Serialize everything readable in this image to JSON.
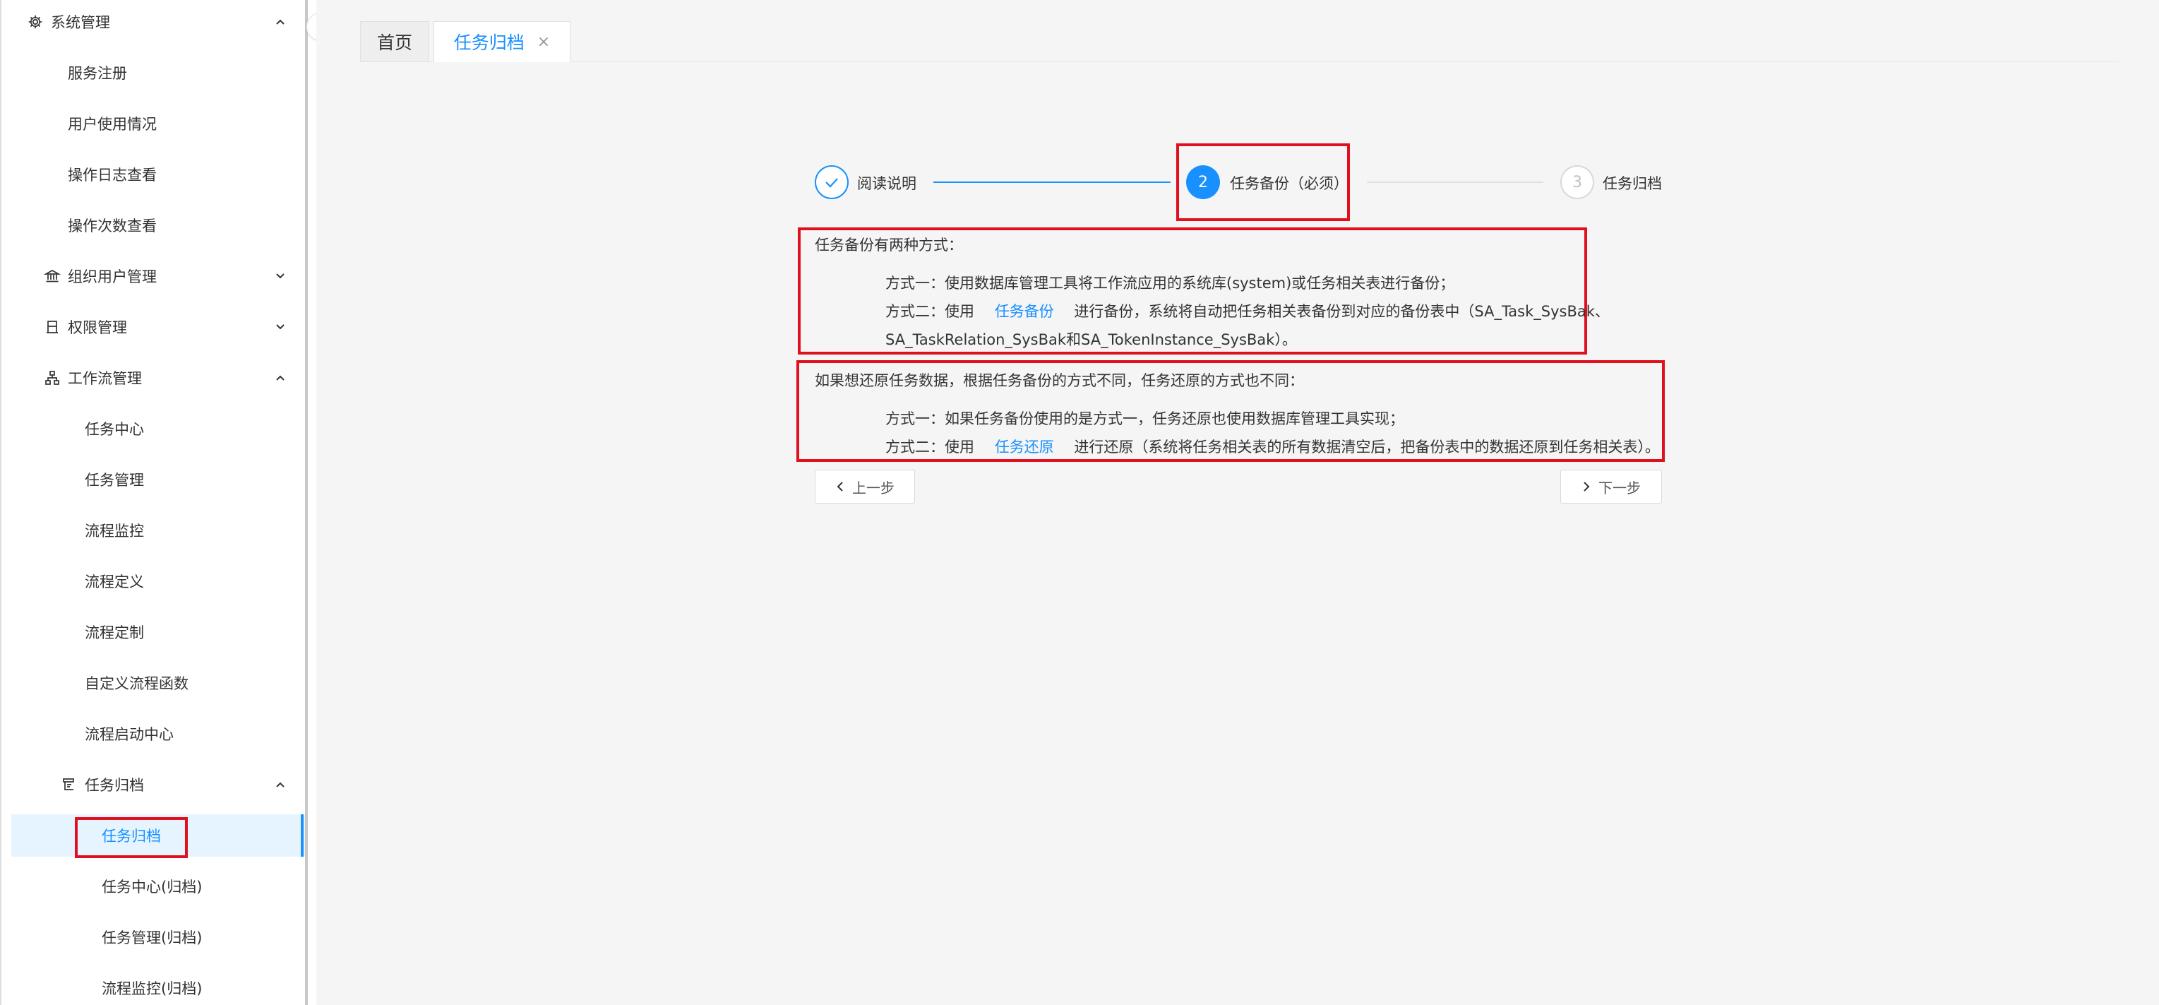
{
  "sidebar": {
    "items": [
      {
        "label": "系统管理",
        "icon": "gear-icon",
        "expand": "up"
      },
      {
        "label": "服务注册"
      },
      {
        "label": "用户使用情况"
      },
      {
        "label": "操作日志查看"
      },
      {
        "label": "操作次数查看"
      },
      {
        "label": "组织用户管理",
        "icon": "bank-icon",
        "expand": "down"
      },
      {
        "label": "权限管理",
        "icon": "permission-icon",
        "expand": "down"
      },
      {
        "label": "工作流管理",
        "icon": "workflow-icon",
        "expand": "up"
      },
      {
        "label": "任务中心"
      },
      {
        "label": "任务管理"
      },
      {
        "label": "流程监控"
      },
      {
        "label": "流程定义"
      },
      {
        "label": "流程定制"
      },
      {
        "label": "自定义流程函数"
      },
      {
        "label": "流程启动中心"
      },
      {
        "label": "任务归档",
        "icon": "archive-icon",
        "expand": "up"
      },
      {
        "label": "任务归档",
        "active": true
      },
      {
        "label": "任务中心(归档)"
      },
      {
        "label": "任务管理(归档)"
      },
      {
        "label": "流程监控(归档)"
      }
    ]
  },
  "tabs": {
    "home": "首页",
    "current": "任务归档",
    "close_symbol": "×"
  },
  "steps": [
    {
      "label": "阅读说明",
      "state": "done"
    },
    {
      "label": "任务备份（必须）",
      "number": "2",
      "state": "active"
    },
    {
      "label": "任务归档",
      "number": "3",
      "state": "wait"
    }
  ],
  "content": {
    "backup_intro": "任务备份有两种方式：",
    "backup_method1": "方式一：使用数据库管理工具将工作流应用的系统库(system)或任务相关表进行备份；",
    "backup_method2_prefix": "方式二：使用",
    "backup_method2_link": "任务备份",
    "backup_method2_suffix": "进行备份，系统将自动把任务相关表备份到对应的备份表中（SA_Task_SysBak、",
    "backup_method2_line2": "SA_TaskRelation_SysBak和SA_TokenInstance_SysBak）。",
    "restore_intro": "如果想还原任务数据，根据任务备份的方式不同，任务还原的方式也不同：",
    "restore_method1": "方式一：如果任务备份使用的是方式一，任务还原也使用数据库管理工具实现；",
    "restore_method2_prefix": "方式二：使用",
    "restore_method2_link": "任务还原",
    "restore_method2_suffix": "进行还原（系统将任务相关表的所有数据清空后，把备份表中的数据还原到任务相关表）。"
  },
  "buttons": {
    "prev": "上一步",
    "next": "下一步"
  },
  "colors": {
    "accent": "#1890ff",
    "highlight": "#e0101e",
    "active_bg": "#e6f4ff"
  }
}
